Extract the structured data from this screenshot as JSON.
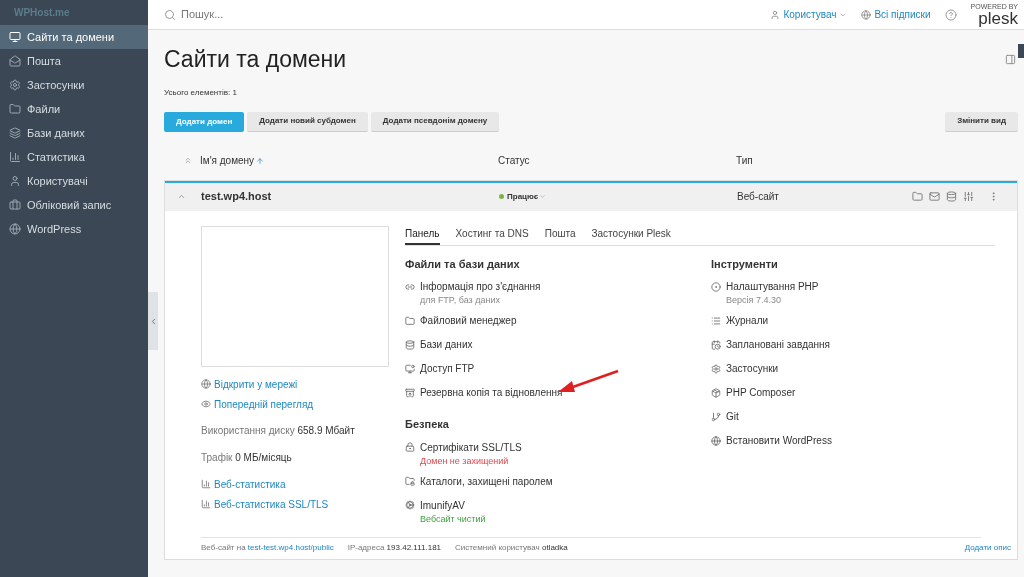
{
  "sidebar": {
    "logo": "WPHost.me",
    "items": [
      {
        "label": "Сайти та домени",
        "selected": true
      },
      {
        "label": "Пошта",
        "selected": false
      },
      {
        "label": "Застосунки",
        "selected": false
      },
      {
        "label": "Файли",
        "selected": false
      },
      {
        "label": "Бази даних",
        "selected": false
      },
      {
        "label": "Статистика",
        "selected": false
      },
      {
        "label": "Користувачі",
        "selected": false
      },
      {
        "label": "Обліковий запис",
        "selected": false
      },
      {
        "label": "WordPress",
        "selected": false
      }
    ]
  },
  "topbar": {
    "search": {
      "placeholder": "Пошук..."
    },
    "user": "Користувач",
    "subscriptions": "Всі підписки",
    "powered_by": "POWERED BY",
    "brand": "plesk"
  },
  "page": {
    "title": "Сайти та домени",
    "total": "Усього елементів: 1",
    "buttons": [
      {
        "label": "Додати домен",
        "primary": true
      },
      {
        "label": "Додати новий субдомен",
        "primary": false
      },
      {
        "label": "Додати псевдонім домену",
        "primary": false
      }
    ],
    "view_button": "Змінити вид"
  },
  "table": {
    "columns": [
      {
        "label": "Ім'я домену",
        "sorted": true
      },
      {
        "label": "Статус",
        "sorted": false
      },
      {
        "label": "Тип",
        "sorted": false
      }
    ],
    "row": {
      "domain": "test.wp4.host",
      "status": "Працює",
      "color": "#7cb342",
      "type": "Веб-сайт",
      "expanded": true
    }
  },
  "details": {
    "links": [
      "Відкрити у мережі",
      "Попередній перегляд"
    ],
    "stats": [
      {
        "label": "Використання диску",
        "value": "658.9 Мбайт"
      },
      {
        "label": "Трафік",
        "value": "0 МБ/місяць"
      }
    ],
    "stat_links": [
      "Веб-статистика",
      "Веб-статистика SSL/TLS"
    ],
    "tabs": [
      {
        "label": "Панель",
        "selected": true
      },
      {
        "label": "Хостинг та DNS",
        "selected": false
      },
      {
        "label": "Пошта",
        "selected": false
      },
      {
        "label": "Застосунки Plesk",
        "selected": false
      }
    ],
    "columns": [
      [
        {
          "heading": "Файли та бази даних",
          "items": [
            {
              "label": "Інформація про з'єднання",
              "note": {
                "text": "для FTP, баз даних",
                "kind": "muted"
              }
            },
            {
              "label": "Файловий менеджер"
            },
            {
              "label": "Бази даних"
            },
            {
              "label": "Доступ FTP"
            },
            {
              "label": "Резервна копія та відновлення"
            }
          ]
        },
        {
          "heading": "Безпека",
          "items": [
            {
              "label": "Сертифікати SSL/TLS",
              "note": {
                "text": "Домен не захищений",
                "kind": "error"
              }
            },
            {
              "label": "Каталоги, захищені паролем"
            },
            {
              "label": "ImunifyAV",
              "note": {
                "text": "Вебсайт чистий",
                "kind": "ok"
              }
            }
          ]
        }
      ],
      [
        {
          "heading": "Інструменти",
          "items": [
            {
              "label": "Налаштування PHP",
              "note": {
                "text": "Версія 7.4.30",
                "kind": "muted"
              }
            },
            {
              "label": "Журнали"
            },
            {
              "label": "Заплановані завдання"
            },
            {
              "label": "Застосунки"
            },
            {
              "label": "PHP Composer"
            },
            {
              "label": "Git"
            },
            {
              "label": "Встановити WordPress"
            }
          ]
        }
      ]
    ],
    "footer": {
      "site_label": "Веб-сайт на",
      "site_link": "test-test.wp4.host/public",
      "ip_label": "IP-адреса",
      "ip": "193.42.111.181",
      "user_label": "Системний користувач",
      "user": "otladka",
      "add_description": "Додати опис"
    }
  }
}
